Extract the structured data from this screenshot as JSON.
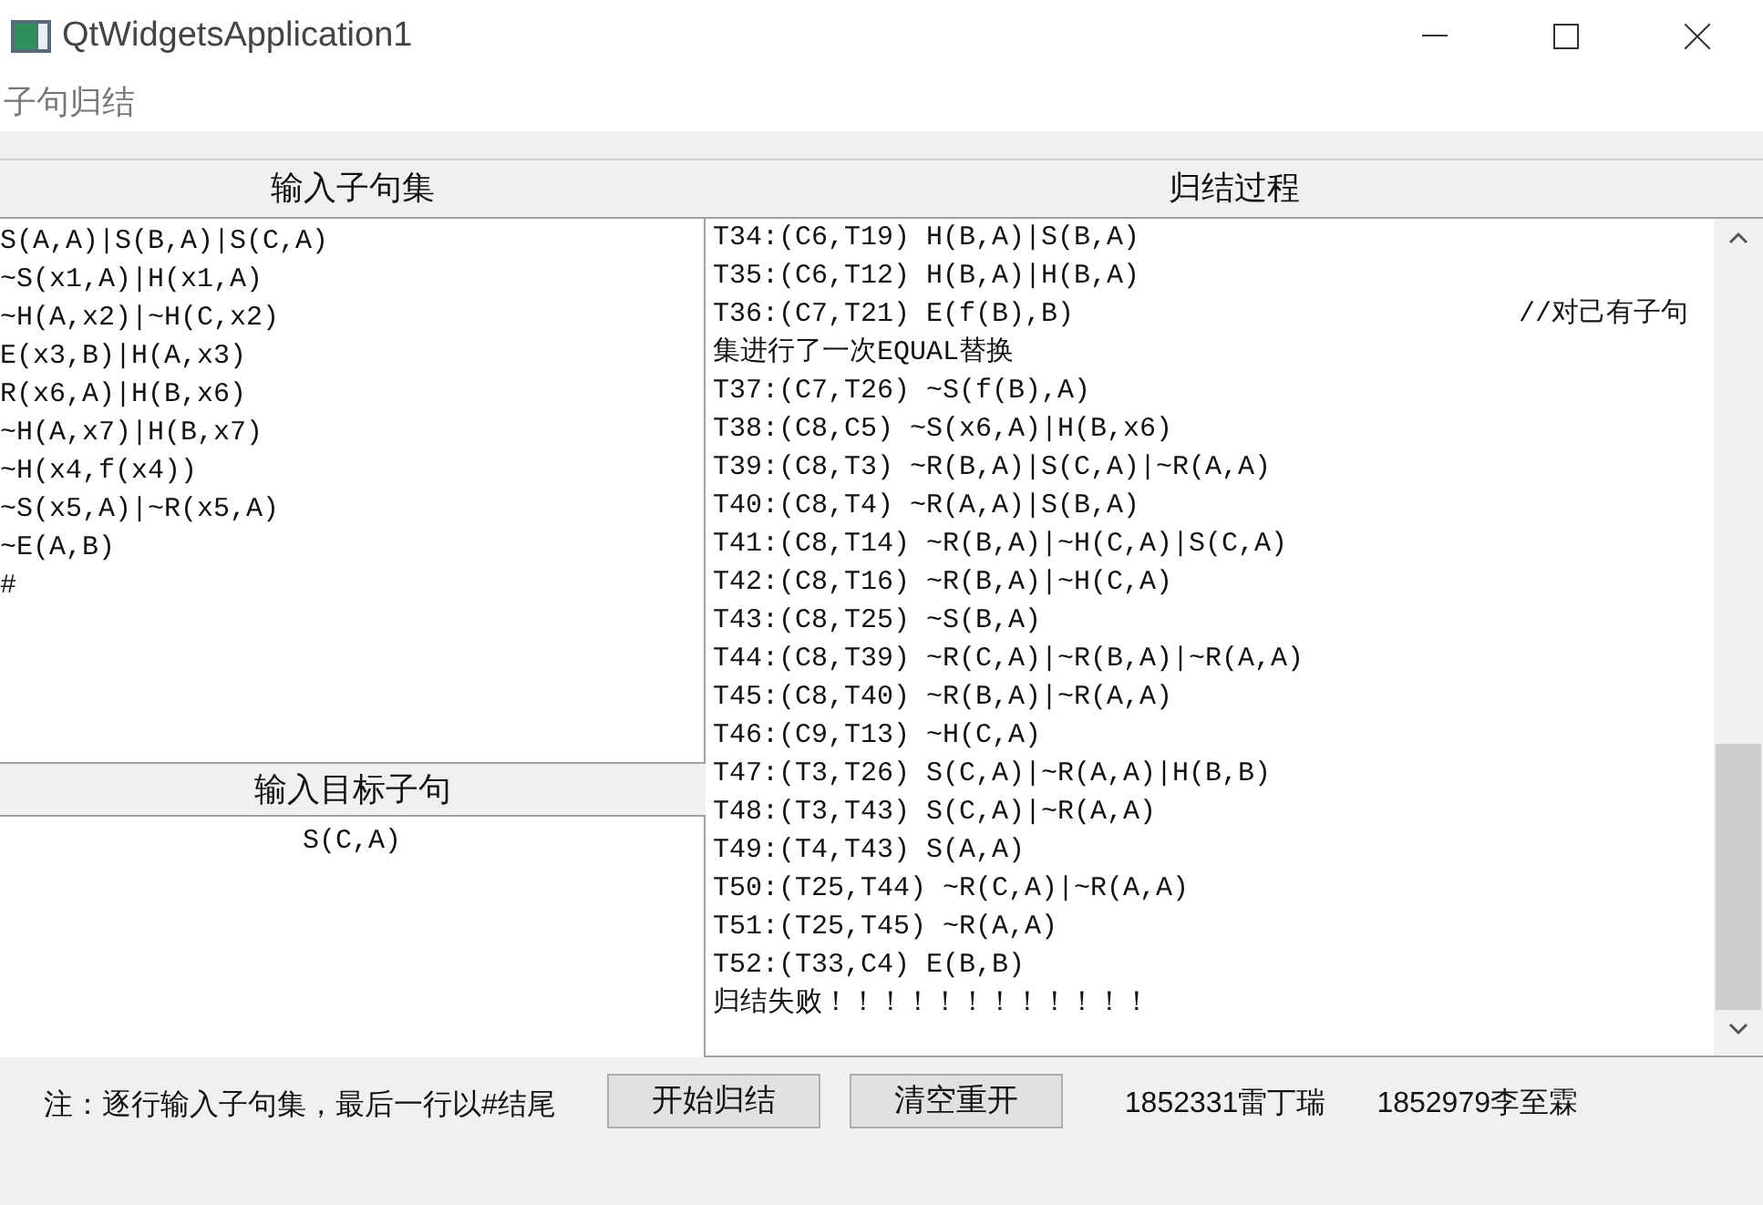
{
  "window": {
    "title": "QtWidgetsApplication1"
  },
  "menu": [
    "子句归结"
  ],
  "input_panel": {
    "header": "输入子句集",
    "lines": [
      "S(A,A)|S(B,A)|S(C,A)",
      "~S(x1,A)|H(x1,A)",
      "~H(A,x2)|~H(C,x2)",
      "E(x3,B)|H(A,x3)",
      "R(x6,A)|H(B,x6)",
      "~H(A,x7)|H(B,x7)",
      "~H(x4,f(x4))",
      "~S(x5,A)|~R(x5,A)",
      "~E(A,B)",
      "#"
    ]
  },
  "target_panel": {
    "header": "输入目标子句",
    "value": "S(C,A)"
  },
  "process_panel": {
    "header": "归结过程",
    "lines": [
      {
        "text": "T34:(C6,T19) H(B,A)|S(B,A)"
      },
      {
        "text": "T35:(C6,T12) H(B,A)|H(B,A)"
      },
      {
        "text": "T36:(C7,T21) E(f(B),B)",
        "note": "//对己有子句"
      },
      {
        "text": "集进行了一次EQUAL替换"
      },
      {
        "text": "T37:(C7,T26) ~S(f(B),A)"
      },
      {
        "text": "T38:(C8,C5) ~S(x6,A)|H(B,x6)"
      },
      {
        "text": "T39:(C8,T3) ~R(B,A)|S(C,A)|~R(A,A)"
      },
      {
        "text": "T40:(C8,T4) ~R(A,A)|S(B,A)"
      },
      {
        "text": "T41:(C8,T14) ~R(B,A)|~H(C,A)|S(C,A)"
      },
      {
        "text": "T42:(C8,T16) ~R(B,A)|~H(C,A)"
      },
      {
        "text": "T43:(C8,T25) ~S(B,A)"
      },
      {
        "text": "T44:(C8,T39) ~R(C,A)|~R(B,A)|~R(A,A)"
      },
      {
        "text": "T45:(C8,T40) ~R(B,A)|~R(A,A)"
      },
      {
        "text": "T46:(C9,T13) ~H(C,A)"
      },
      {
        "text": "T47:(T3,T26) S(C,A)|~R(A,A)|H(B,B)"
      },
      {
        "text": "T48:(T3,T43) S(C,A)|~R(A,A)"
      },
      {
        "text": "T49:(T4,T43) S(A,A)"
      },
      {
        "text": "T50:(T25,T44) ~R(C,A)|~R(A,A)"
      },
      {
        "text": "T51:(T25,T45) ~R(A,A)"
      },
      {
        "text": "T52:(T33,C4) E(B,B)"
      },
      {
        "text": "归结失败！！！！！！！！！！！！"
      }
    ]
  },
  "footer": {
    "note": "注：逐行输入子句集，最后一行以#结尾",
    "buttons": [
      "开始归结",
      "清空重开"
    ],
    "authors": [
      "1852331雷丁瑞",
      "1852979李至霖"
    ]
  }
}
